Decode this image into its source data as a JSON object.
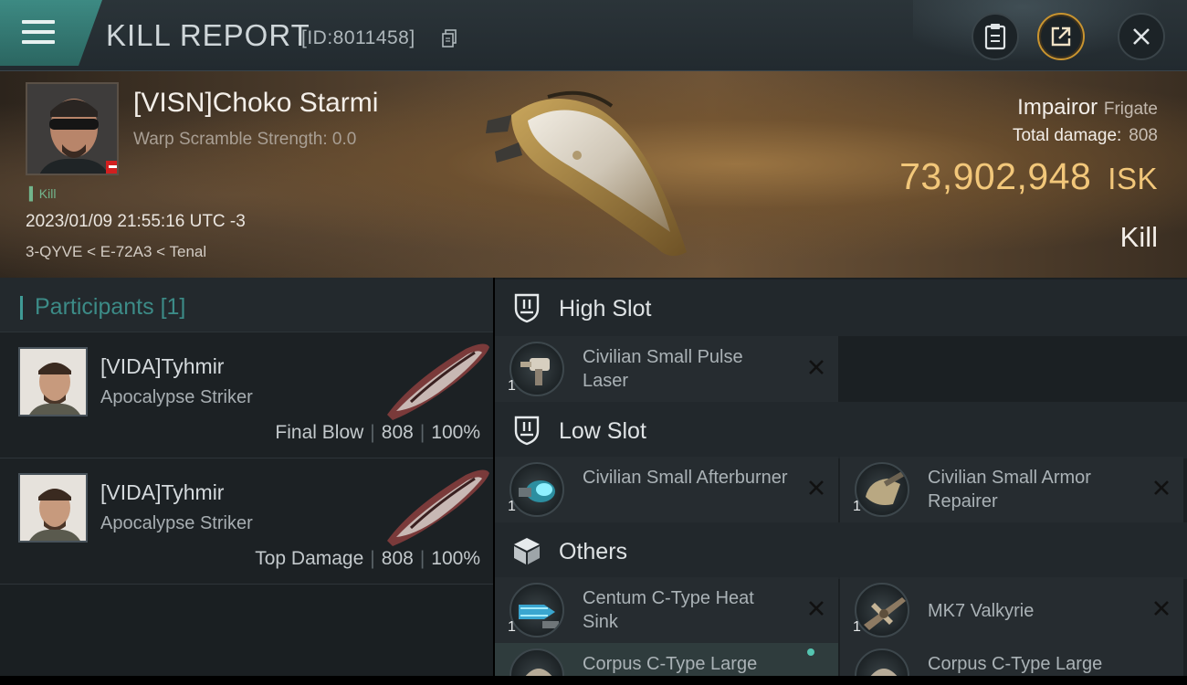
{
  "header": {
    "title": "KILL REPORT",
    "report_id": "[ID:8011458]",
    "icons": [
      "menu-icon",
      "copy-icon",
      "clipboard-icon",
      "share-icon",
      "close-icon"
    ]
  },
  "victim": {
    "name": "[VISN]Choko Starmi",
    "warp_scramble": "Warp Scramble Strength: 0.0",
    "kill_tag": "Kill",
    "datetime": "2023/01/09 21:55:16 UTC -3",
    "location": "3-QYVE < E-72A3 < Tenal",
    "ship_name": "Impairor",
    "ship_class": "Frigate",
    "total_damage_label": "Total damage:",
    "total_damage_value": "808",
    "isk_value": "73,902,948",
    "isk_unit": "ISK",
    "result": "Kill"
  },
  "participants": {
    "title": "Participants",
    "count": "[1]",
    "rows": [
      {
        "name": "[VIDA]Tyhmir",
        "ship": "Apocalypse Striker",
        "role": "Final Blow",
        "damage": "808",
        "percent": "100%"
      },
      {
        "name": "[VIDA]Tyhmir",
        "ship": "Apocalypse Striker",
        "role": "Top Damage",
        "damage": "808",
        "percent": "100%"
      }
    ]
  },
  "fitting": {
    "high_slot": {
      "label": "High Slot",
      "items": [
        {
          "name": "Civilian Small Pulse Laser",
          "qty": "1"
        }
      ]
    },
    "low_slot": {
      "label": "Low Slot",
      "items": [
        {
          "name": "Civilian Small Afterburner",
          "qty": "1"
        },
        {
          "name": "Civilian Small Armor Repairer",
          "qty": "1"
        }
      ]
    },
    "others": {
      "label": "Others",
      "items": [
        {
          "name": "Centum C-Type Heat Sink",
          "qty": "1"
        },
        {
          "name": "MK7  Valkyrie",
          "qty": "1"
        },
        {
          "name": "Corpus C-Type Large",
          "qty": ""
        },
        {
          "name": "Corpus C-Type Large",
          "qty": ""
        }
      ]
    }
  },
  "colors": {
    "accent_teal": "#3d8a83",
    "isk_gold": "#f2c77a",
    "share_ring": "#c9942f",
    "kill_green": "#72b58c"
  }
}
